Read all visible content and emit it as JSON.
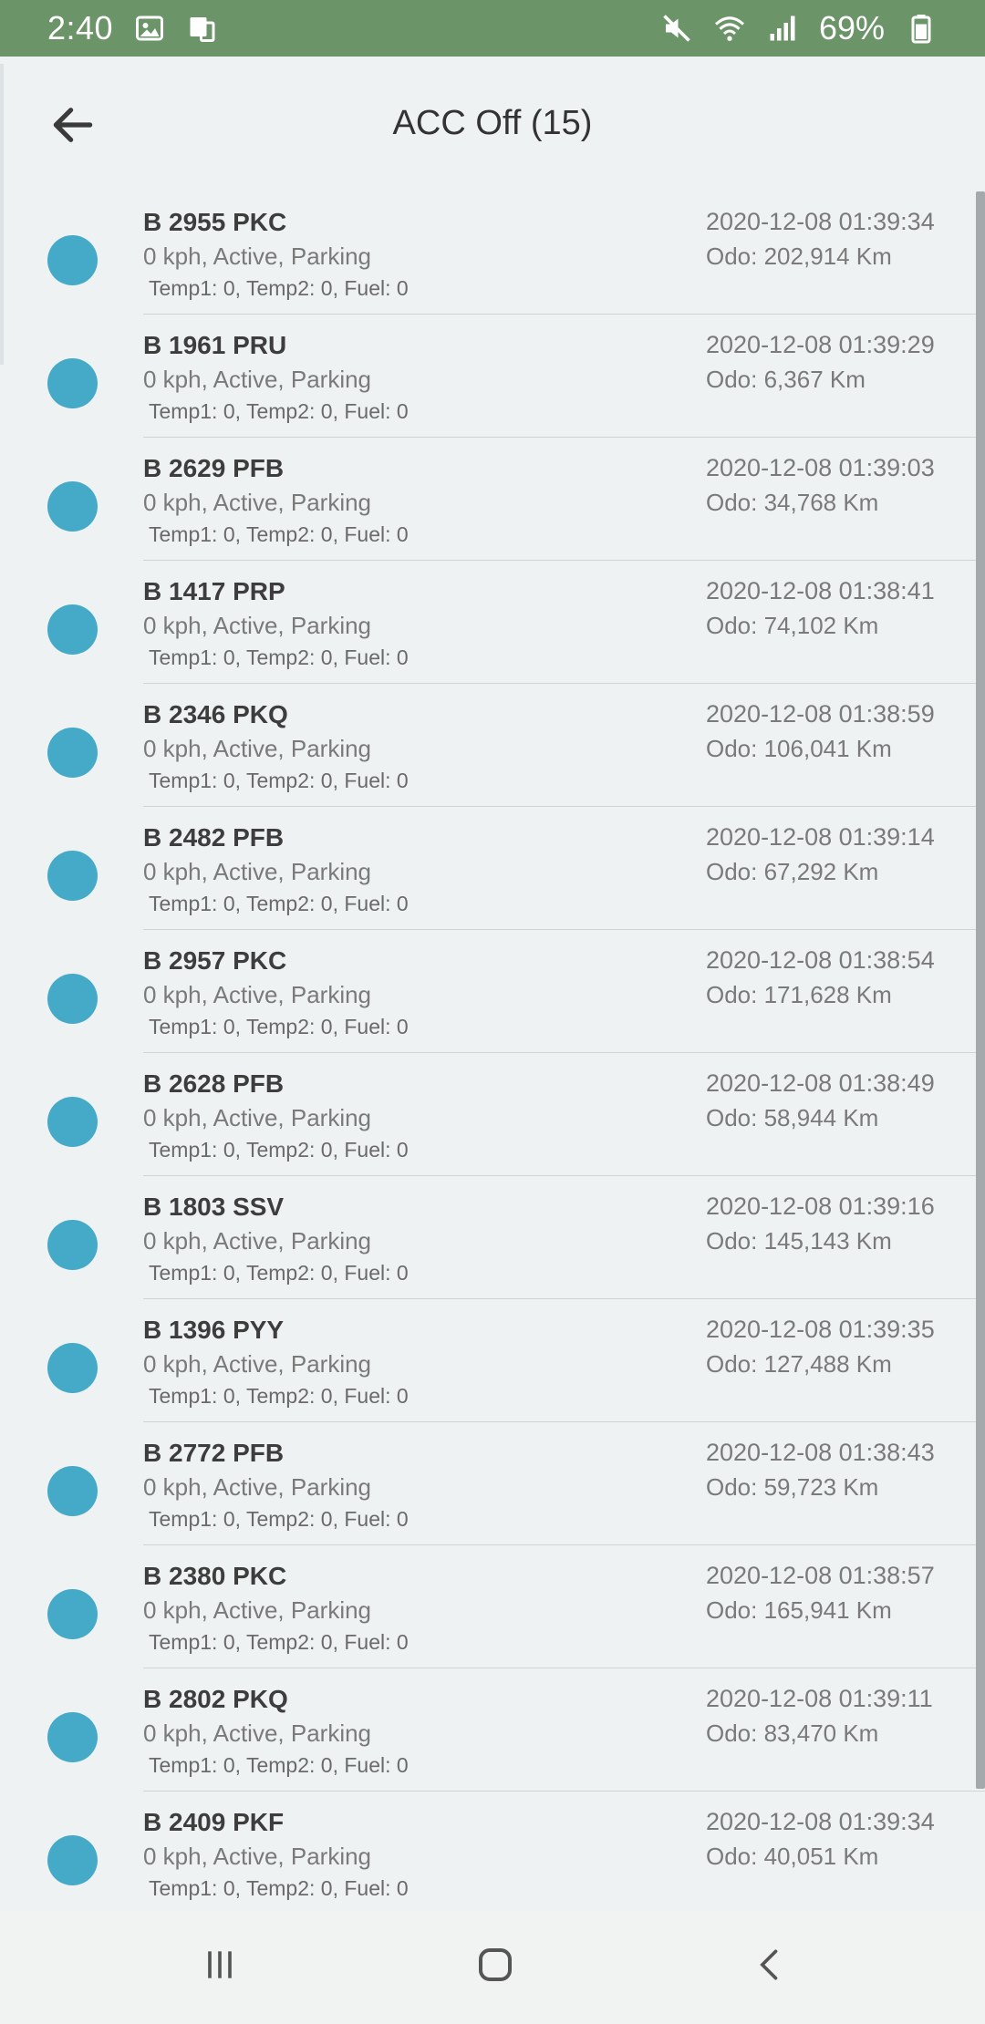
{
  "status_bar": {
    "time": "2:40",
    "battery": "69%",
    "icons": [
      "image-icon",
      "screen-mirror-icon",
      "mute-icon",
      "wifi-icon",
      "signal-icon",
      "battery-icon"
    ]
  },
  "header": {
    "title": "ACC Off (15)",
    "back_icon": "arrow-left-icon"
  },
  "colors": {
    "status_bar": "#6b9468",
    "status_dot": "#45aac8",
    "background": "#eef2f3"
  },
  "vehicles": [
    {
      "plate": "B 2955 PKC",
      "status": "0 kph, Active, Parking",
      "sensors": "Temp1: 0, Temp2: 0, Fuel: 0",
      "datetime": "2020-12-08 01:39:34",
      "odo": "Odo: 202,914 Km"
    },
    {
      "plate": "B 1961 PRU",
      "status": "0 kph, Active, Parking",
      "sensors": "Temp1: 0, Temp2: 0, Fuel: 0",
      "datetime": "2020-12-08 01:39:29",
      "odo": "Odo: 6,367 Km"
    },
    {
      "plate": "B 2629 PFB",
      "status": "0 kph, Active, Parking",
      "sensors": "Temp1: 0, Temp2: 0, Fuel: 0",
      "datetime": "2020-12-08 01:39:03",
      "odo": "Odo: 34,768 Km"
    },
    {
      "plate": "B 1417 PRP",
      "status": "0 kph, Active, Parking",
      "sensors": "Temp1: 0, Temp2: 0, Fuel: 0",
      "datetime": "2020-12-08 01:38:41",
      "odo": "Odo: 74,102 Km"
    },
    {
      "plate": "B 2346 PKQ",
      "status": "0 kph, Active, Parking",
      "sensors": "Temp1: 0, Temp2: 0, Fuel: 0",
      "datetime": "2020-12-08 01:38:59",
      "odo": "Odo: 106,041 Km"
    },
    {
      "plate": "B 2482 PFB",
      "status": "0 kph, Active, Parking",
      "sensors": "Temp1: 0, Temp2: 0, Fuel: 0",
      "datetime": "2020-12-08 01:39:14",
      "odo": "Odo: 67,292 Km"
    },
    {
      "plate": "B 2957 PKC",
      "status": "0 kph, Active, Parking",
      "sensors": "Temp1: 0, Temp2: 0, Fuel: 0",
      "datetime": "2020-12-08 01:38:54",
      "odo": "Odo: 171,628 Km"
    },
    {
      "plate": "B 2628 PFB",
      "status": "0 kph, Active, Parking",
      "sensors": "Temp1: 0, Temp2: 0, Fuel: 0",
      "datetime": "2020-12-08 01:38:49",
      "odo": "Odo: 58,944 Km"
    },
    {
      "plate": "B 1803 SSV",
      "status": "0 kph, Active, Parking",
      "sensors": "Temp1: 0, Temp2: 0, Fuel: 0",
      "datetime": "2020-12-08 01:39:16",
      "odo": "Odo: 145,143 Km"
    },
    {
      "plate": "B 1396 PYY",
      "status": "0 kph, Active, Parking",
      "sensors": "Temp1: 0, Temp2: 0, Fuel: 0",
      "datetime": "2020-12-08 01:39:35",
      "odo": "Odo: 127,488 Km"
    },
    {
      "plate": "B 2772 PFB",
      "status": "0 kph, Active, Parking",
      "sensors": "Temp1: 0, Temp2: 0, Fuel: 0",
      "datetime": "2020-12-08 01:38:43",
      "odo": "Odo: 59,723 Km"
    },
    {
      "plate": "B 2380 PKC",
      "status": "0 kph, Active, Parking",
      "sensors": "Temp1: 0, Temp2: 0, Fuel: 0",
      "datetime": "2020-12-08 01:38:57",
      "odo": "Odo: 165,941 Km"
    },
    {
      "plate": "B 2802 PKQ",
      "status": "0 kph, Active, Parking",
      "sensors": "Temp1: 0, Temp2: 0, Fuel: 0",
      "datetime": "2020-12-08 01:39:11",
      "odo": "Odo: 83,470 Km"
    },
    {
      "plate": "B 2409 PKF",
      "status": "0 kph, Active, Parking",
      "sensors": "Temp1: 0, Temp2: 0, Fuel: 0",
      "datetime": "2020-12-08 01:39:34",
      "odo": "Odo: 40,051 Km"
    }
  ],
  "nav_bar": {
    "icons": [
      "recent-apps-icon",
      "home-icon",
      "back-icon"
    ]
  }
}
